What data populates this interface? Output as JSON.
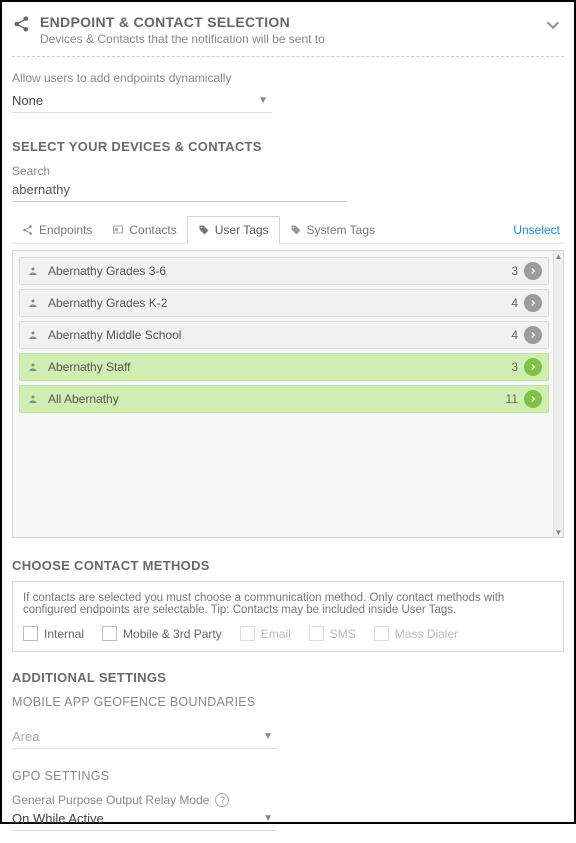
{
  "header": {
    "title": "ENDPOINT & CONTACT SELECTION",
    "subtitle": "Devices & Contacts that the notification will be sent to"
  },
  "dynamicEndpoints": {
    "label": "Allow users to add endpoints dynamically",
    "value": "None"
  },
  "devices": {
    "title": "SELECT YOUR DEVICES & CONTACTS",
    "searchLabel": "Search",
    "searchValue": "abernathy",
    "tabs": {
      "endpoints": "Endpoints",
      "contacts": "Contacts",
      "userTags": "User Tags",
      "systemTags": "System Tags"
    },
    "unselect": "Unselect",
    "tags": [
      {
        "label": "Abernathy Grades 3-6",
        "count": "3",
        "selected": false
      },
      {
        "label": "Abernathy Grades K-2",
        "count": "4",
        "selected": false
      },
      {
        "label": "Abernathy Middle School",
        "count": "4",
        "selected": false
      },
      {
        "label": "Abernathy Staff",
        "count": "3",
        "selected": true
      },
      {
        "label": "All Abernathy",
        "count": "11",
        "selected": true
      }
    ]
  },
  "methods": {
    "title": "CHOOSE CONTACT METHODS",
    "help": "If contacts are selected you must choose a communication method. Only contact methods with configured endpoints are selectable. Tip: Contacts may be included inside User Tags.",
    "options": {
      "internal": "Internal",
      "mobile": "Mobile & 3rd Party",
      "email": "Email",
      "sms": "SMS",
      "massDialer": "Mass Dialer"
    }
  },
  "additional": {
    "title": "ADDITIONAL SETTINGS",
    "geofenceTitle": "MOBILE APP GEOFENCE BOUNDARIES",
    "areaPlaceholder": "Area",
    "gpoTitle": "GPO SETTINGS",
    "gpoLabel": "General Purpose Output Relay Mode",
    "gpoValue": "On While Active"
  }
}
